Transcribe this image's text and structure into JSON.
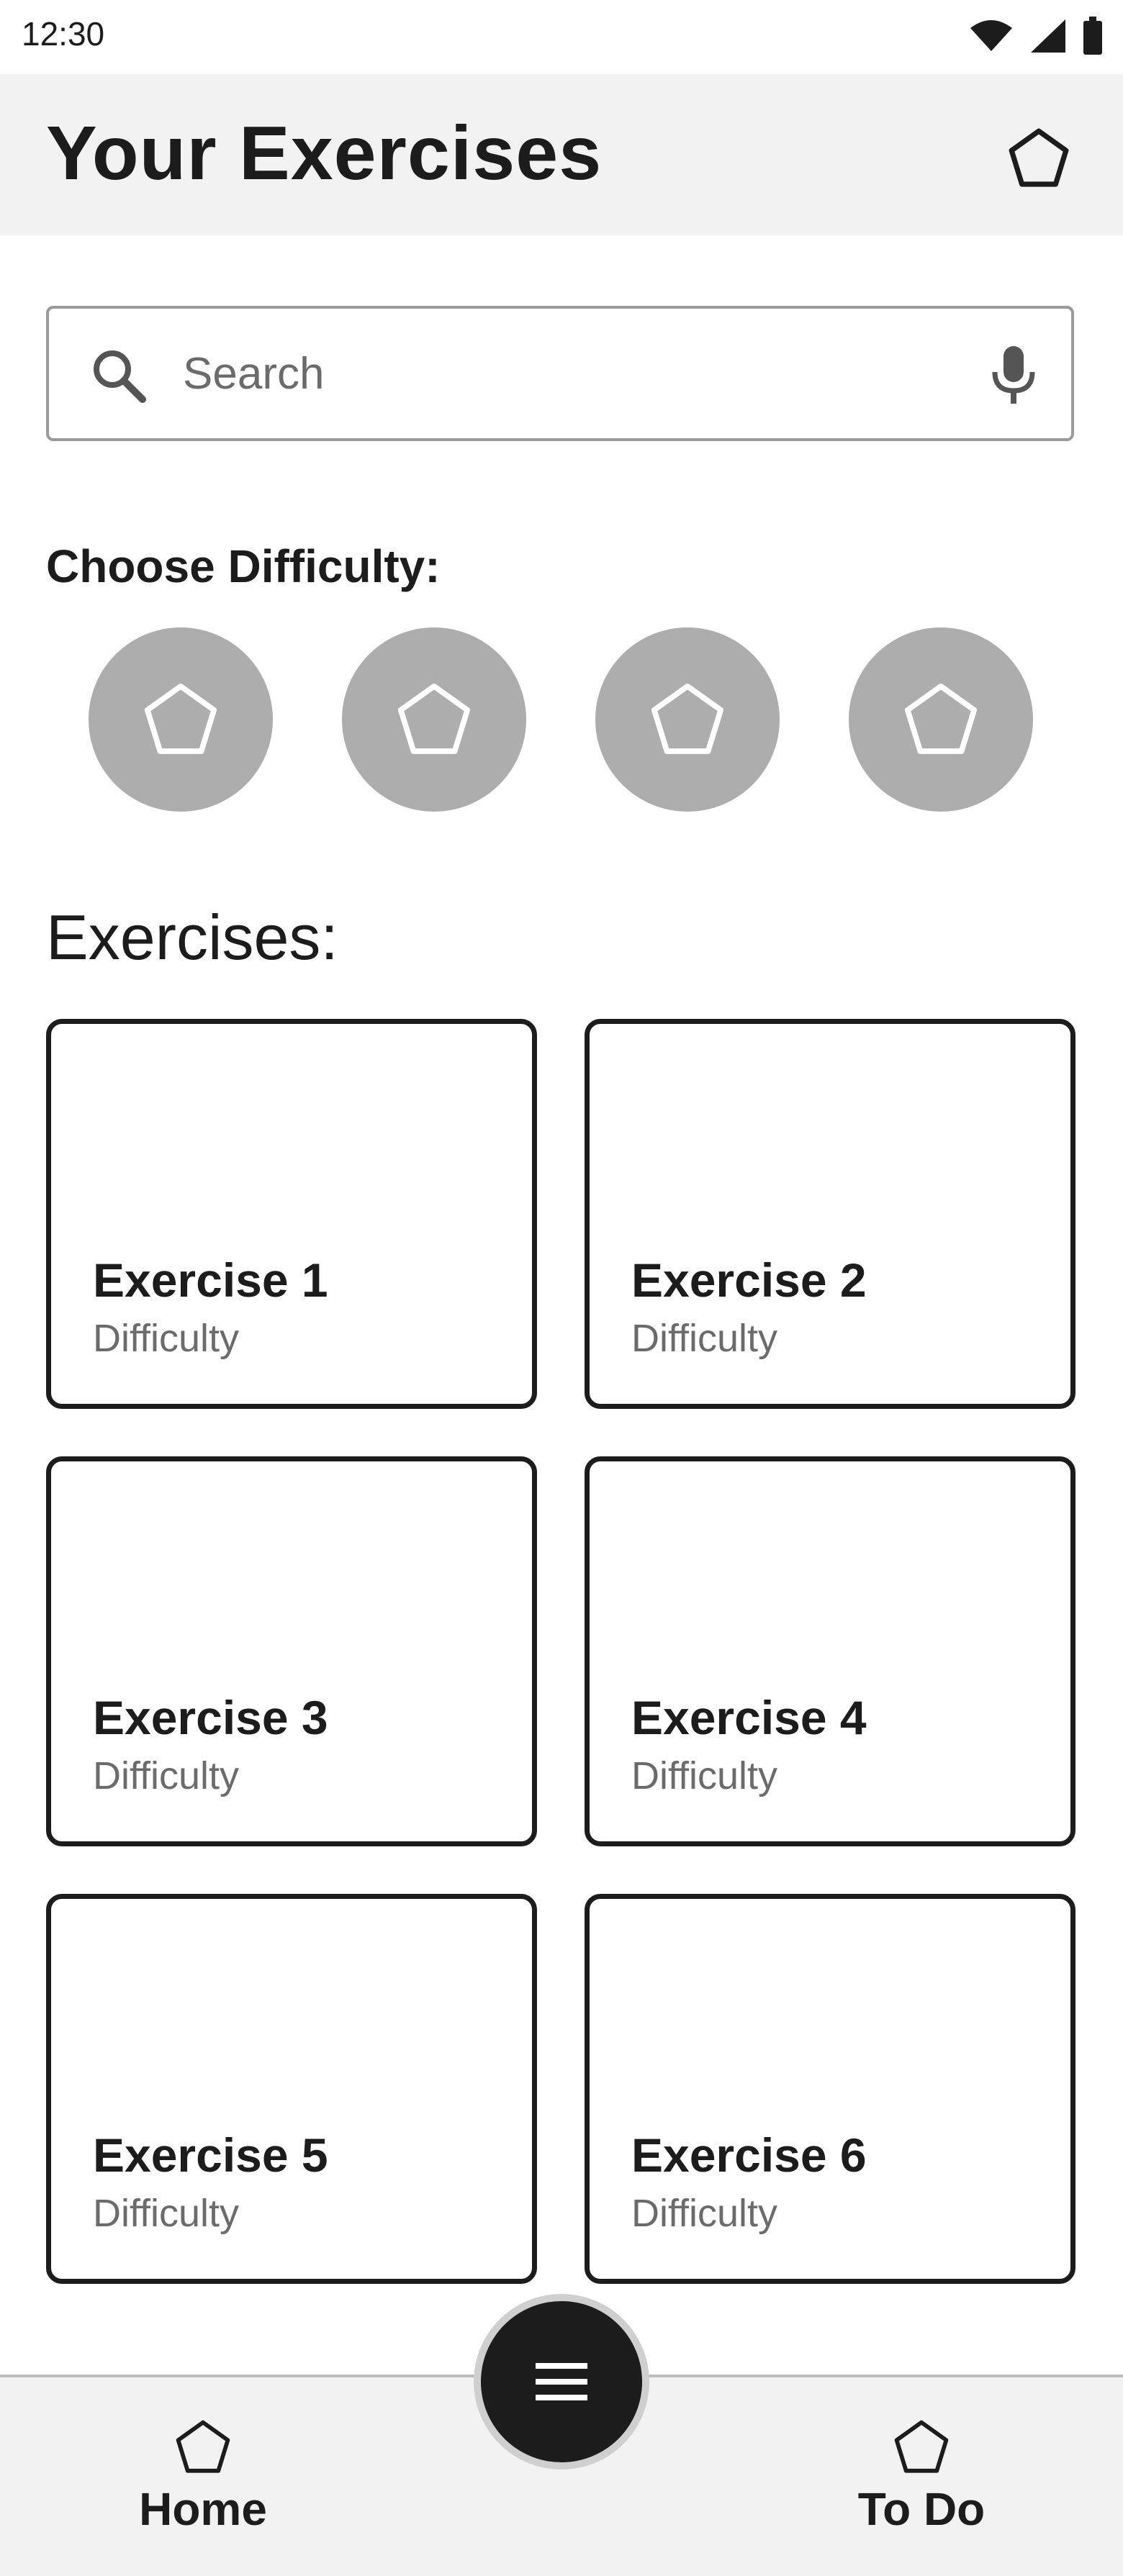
{
  "status_bar": {
    "time": "12:30"
  },
  "app_bar": {
    "title": "Your Exercises",
    "action_icon": "pentagon-icon"
  },
  "search": {
    "placeholder": "Search",
    "value": ""
  },
  "difficulty": {
    "label": "Choose Difficulty:",
    "options": [
      "pentagon-icon",
      "pentagon-icon",
      "pentagon-icon",
      "pentagon-icon"
    ]
  },
  "exercises": {
    "title": "Exercises:",
    "items": [
      {
        "title": "Exercise 1",
        "subtitle": "Difficulty"
      },
      {
        "title": "Exercise 2",
        "subtitle": "Difficulty"
      },
      {
        "title": "Exercise 3",
        "subtitle": "Difficulty"
      },
      {
        "title": "Exercise 4",
        "subtitle": "Difficulty"
      },
      {
        "title": "Exercise 5",
        "subtitle": "Difficulty"
      },
      {
        "title": "Exercise 6",
        "subtitle": "Difficulty"
      }
    ]
  },
  "bottom_nav": {
    "home_label": "Home",
    "todo_label": "To Do",
    "fab_icon": "menu-icon"
  },
  "colors": {
    "bar_background": "#f2f2f2",
    "text_primary": "#1c1c1c",
    "text_secondary": "#6b6b6b",
    "difficulty_circle": "#adadad",
    "fab": "#1c1c1c"
  }
}
